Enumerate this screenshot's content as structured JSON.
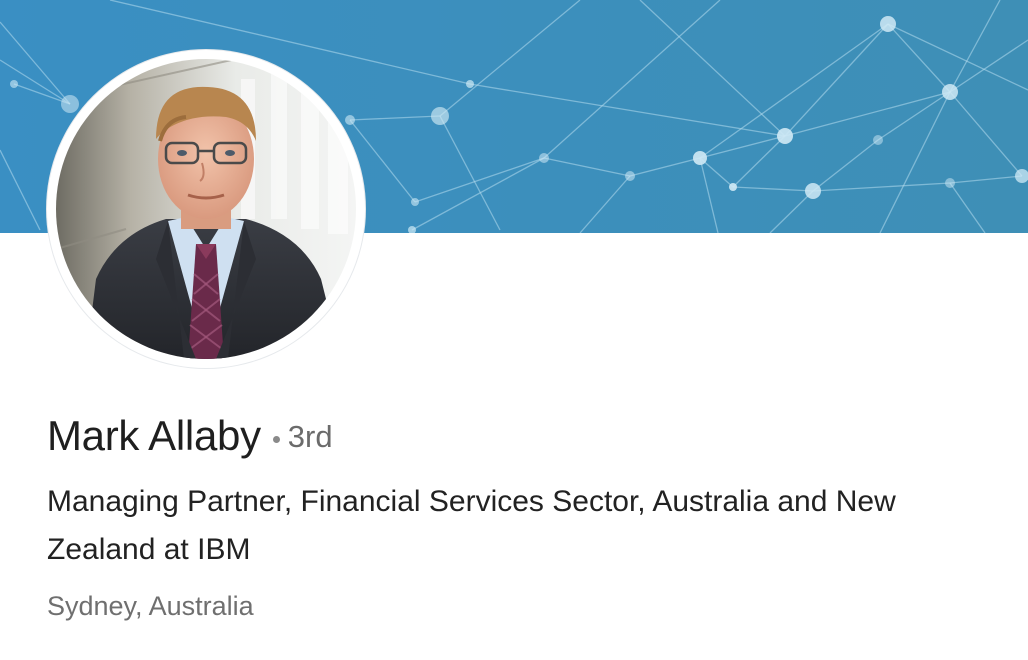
{
  "profile": {
    "name": "Mark Allaby",
    "degree": "3rd",
    "headline": "Managing Partner, Financial Services Sector, Australia and New Zealand at IBM",
    "location": "Sydney, Australia"
  },
  "colors": {
    "banner": "#3a8fc0",
    "name_text": "#1f1f1f",
    "secondary_text": "#6f6f6f"
  },
  "icons": {
    "degree_separator": "bullet-icon"
  }
}
